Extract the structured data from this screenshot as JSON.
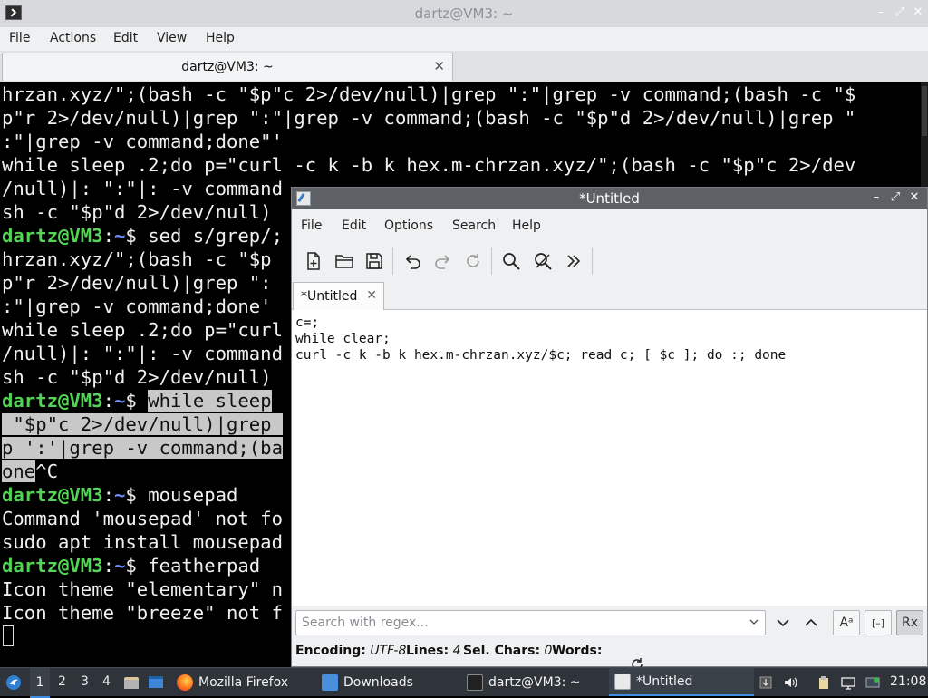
{
  "terminal": {
    "window_title": "dartz@VM3: ~",
    "menu": [
      "File",
      "Actions",
      "Edit",
      "View",
      "Help"
    ],
    "tab_label": "dartz@VM3: ~",
    "lines": [
      {
        "segments": [
          {
            "t": "hrzan.xyz/\";(bash -c \"$p\"c 2>/dev/null)|grep \":\"|grep -v command;(bash -c \"$"
          }
        ]
      },
      {
        "segments": [
          {
            "t": "p\"r 2>/dev/null)|grep \":\"|grep -v command;(bash -c \"$p\"d 2>/dev/null)|grep \""
          }
        ]
      },
      {
        "segments": [
          {
            "t": ":\"|grep -v command;done\"'"
          }
        ]
      },
      {
        "segments": [
          {
            "t": "while sleep .2;do p=\"curl -c k -b k hex.m-chrzan.xyz/\";(bash -c \"$p\"c 2>/dev"
          }
        ]
      },
      {
        "segments": [
          {
            "t": "/null)|: \":\"|: -v command"
          }
        ]
      },
      {
        "segments": [
          {
            "t": "sh -c \"$p\"d 2>/dev/null)"
          }
        ]
      },
      {
        "segments": [
          {
            "t": "dartz@VM3",
            "c": "prompt-user"
          },
          {
            "t": ":",
            "c": ""
          },
          {
            "t": "~",
            "c": "prompt-path"
          },
          {
            "t": "$ sed s/grep/;"
          }
        ]
      },
      {
        "segments": [
          {
            "t": "hrzan.xyz/\";(bash -c \"$p"
          }
        ]
      },
      {
        "segments": [
          {
            "t": "p\"r 2>/dev/null)|grep \":"
          }
        ]
      },
      {
        "segments": [
          {
            "t": ":\"|grep -v command;done'"
          }
        ]
      },
      {
        "segments": [
          {
            "t": "while sleep .2;do p=\"curl"
          }
        ]
      },
      {
        "segments": [
          {
            "t": "/null)|: \":\"|: -v command"
          }
        ]
      },
      {
        "segments": [
          {
            "t": "sh -c \"$p\"d 2>/dev/null)"
          }
        ]
      },
      {
        "segments": [
          {
            "t": "dartz@VM3",
            "c": "prompt-user"
          },
          {
            "t": ":",
            "c": ""
          },
          {
            "t": "~",
            "c": "prompt-path"
          },
          {
            "t": "$ "
          },
          {
            "t": "while sleep",
            "c": "sel"
          }
        ]
      },
      {
        "segments": [
          {
            "t": " \"$p\"c 2>/dev/null)|grep ",
            "c": "sel"
          }
        ]
      },
      {
        "segments": [
          {
            "t": "p ':'|grep -v command;(ba",
            "c": "sel"
          }
        ]
      },
      {
        "segments": [
          {
            "t": "one",
            "c": "sel"
          },
          {
            "t": "^C"
          }
        ]
      },
      {
        "segments": [
          {
            "t": "dartz@VM3",
            "c": "prompt-user"
          },
          {
            "t": ":",
            "c": ""
          },
          {
            "t": "~",
            "c": "prompt-path"
          },
          {
            "t": "$ mousepad"
          }
        ]
      },
      {
        "segments": [
          {
            "t": "Command 'mousepad' not fo"
          }
        ]
      },
      {
        "segments": [
          {
            "t": "sudo apt install mousepad"
          }
        ]
      },
      {
        "segments": [
          {
            "t": "dartz@VM3",
            "c": "prompt-user"
          },
          {
            "t": ":",
            "c": ""
          },
          {
            "t": "~",
            "c": "prompt-path"
          },
          {
            "t": "$ featherpad"
          }
        ]
      },
      {
        "segments": [
          {
            "t": "Icon theme \"elementary\" n"
          }
        ]
      },
      {
        "segments": [
          {
            "t": "Icon theme \"breeze\" not f"
          }
        ]
      }
    ]
  },
  "featherpad": {
    "window_title": "*Untitled",
    "menu": [
      "File",
      "Edit",
      "Options",
      "Search",
      "Help"
    ],
    "tab_label": "*Untitled",
    "editor_lines": [
      "c=;",
      "while clear;",
      "curl -c k -b k hex.m-chrzan.xyz/$c; read c; [ $c ]; do :; done"
    ],
    "search": {
      "placeholder": "Search with regex...",
      "value": "",
      "case_button": "Aᵃ",
      "whole_word_button": "[–]",
      "regex_button": "Rx"
    },
    "status": {
      "encoding_label": "Encoding:",
      "encoding_value": "UTF-8",
      "lines_label": "Lines:",
      "lines_value": "4",
      "sel_label": "Sel. Chars:",
      "sel_value": "0",
      "words_label": "Words:"
    }
  },
  "taskbar": {
    "workspaces": [
      "1",
      "2",
      "3",
      "4"
    ],
    "tasks": [
      {
        "label": "Mozilla Firefox",
        "icon": "firefox-icon"
      },
      {
        "label": "Downloads",
        "icon": "folder-icon"
      },
      {
        "label": "dartz@VM3: ~",
        "icon": "terminal-icon"
      },
      {
        "label": "*Untitled",
        "icon": "featherpad-icon"
      }
    ],
    "clock": "21:08"
  }
}
